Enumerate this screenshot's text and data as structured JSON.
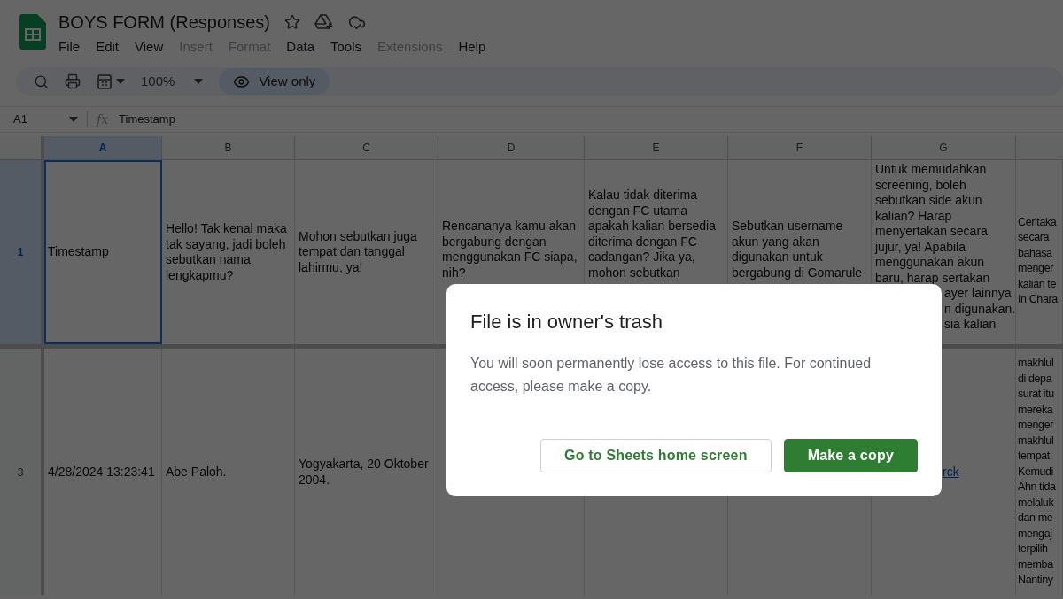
{
  "title": "BOYS FORM (Responses)",
  "menu": [
    {
      "label": "File",
      "disabled": false
    },
    {
      "label": "Edit",
      "disabled": false
    },
    {
      "label": "View",
      "disabled": false
    },
    {
      "label": "Insert",
      "disabled": true
    },
    {
      "label": "Format",
      "disabled": true
    },
    {
      "label": "Data",
      "disabled": false
    },
    {
      "label": "Tools",
      "disabled": false
    },
    {
      "label": "Extensions",
      "disabled": true
    },
    {
      "label": "Help",
      "disabled": false
    }
  ],
  "toolbar": {
    "zoom": "100%",
    "mode": "View only"
  },
  "formula_bar": {
    "cell_ref": "A1",
    "fx": "fx",
    "value": "Timestamp"
  },
  "columns": [
    {
      "label": "A",
      "selected": true
    },
    {
      "label": "B",
      "selected": false
    },
    {
      "label": "C",
      "selected": false
    },
    {
      "label": "D",
      "selected": false
    },
    {
      "label": "E",
      "selected": false
    },
    {
      "label": "F",
      "selected": false
    },
    {
      "label": "G",
      "selected": false
    }
  ],
  "rows": [
    {
      "number": "1",
      "selected": true,
      "cells": [
        {
          "kind": "text",
          "selected": true,
          "text": "Timestamp"
        },
        {
          "kind": "text",
          "selected": false,
          "text": "Hello! Tak kenal maka tak sayang, jadi boleh sebutkan nama lengkapmu?"
        },
        {
          "kind": "text",
          "selected": false,
          "text": "Mohon sebutkan juga tempat dan tanggal lahirmu, ya!"
        },
        {
          "kind": "text",
          "selected": false,
          "text": "Rencananya kamu akan bergabung dengan menggunakan FC siapa, nih?"
        },
        {
          "kind": "text",
          "selected": false,
          "text": "Kalau tidak diterima dengan FC utama apakah kalian bersedia diterima dengan FC cadangan? Jika ya, mohon sebutkan"
        },
        {
          "kind": "text",
          "selected": false,
          "text": "Sebutkan username akun yang akan digunakan untuk bergabung di Gomarule"
        },
        {
          "kind": "text",
          "selected": false,
          "text": "Untuk memudahkan screening, boleh sebutkan side akun kalian? Harap menyertakan secara jujur, ya! Apabila menggunakan akun baru, harap sertakan",
          "fragments": [
            "ayer lainnya",
            "n digunakan.",
            "sia kalian"
          ]
        },
        {
          "kind": "lines",
          "selected": false,
          "lines": [
            "Ceritaka",
            "secara",
            "bahasa",
            "menger",
            "kalian te",
            "In Chara"
          ]
        }
      ]
    },
    {
      "number": "3",
      "selected": false,
      "cells": [
        {
          "kind": "text",
          "selected": false,
          "text": "4/28/2024 13:23:41"
        },
        {
          "kind": "text",
          "selected": false,
          "text": "Abe Paloh."
        },
        {
          "kind": "text",
          "selected": false,
          "text": "Yogyakarta, 20 Oktober 2004."
        },
        {
          "kind": "empty",
          "selected": false
        },
        {
          "kind": "empty",
          "selected": false
        },
        {
          "kind": "empty",
          "selected": false
        },
        {
          "kind": "link",
          "selected": false,
          "text": "rck"
        },
        {
          "kind": "lines",
          "selected": false,
          "lines": [
            "makhlul",
            "di depa",
            "surat itu",
            "mereka",
            "menger",
            "makhlul",
            "tempat",
            "Kemudi",
            "Ahn tida",
            "melaluk",
            "dan me",
            "mengaj",
            "terpilih",
            "memba",
            "Nantiny"
          ]
        }
      ]
    }
  ],
  "dialog": {
    "title": "File is in owner's trash",
    "body": "You will soon permanently lose access to this file. For continued access, please make a copy.",
    "buttons": [
      {
        "label": "Go to Sheets home screen",
        "kind": "secondary"
      },
      {
        "label": "Make a copy",
        "kind": "primary"
      }
    ]
  }
}
